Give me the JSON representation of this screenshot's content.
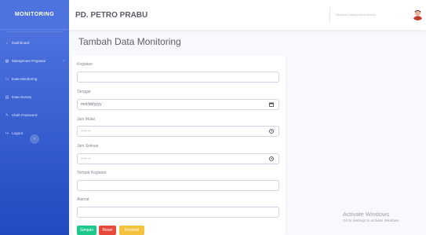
{
  "sidebar": {
    "brand": "MONITORING",
    "items": [
      {
        "label": "Dashboard",
        "icon": "⌂"
      },
      {
        "label": "Manajemen Pegawai",
        "icon": "▦",
        "chevron": "›"
      },
      {
        "label": "Data Monitoring",
        "icon": "▭"
      },
      {
        "label": "Data Survey",
        "icon": "▤"
      },
      {
        "label": "Ubah Password",
        "icon": "✎"
      },
      {
        "label": "Logout",
        "icon": "↦"
      }
    ],
    "toggle": "‹"
  },
  "topbar": {
    "title": "PD. PETRO PRABU",
    "greeting": "Selamat Datang anda Admin"
  },
  "page": {
    "heading": "Tambah Data Monitoring"
  },
  "form": {
    "kegiatan_label": "Kegiatan",
    "kegiatan_value": "",
    "tanggal_label": "Tanggal",
    "tanggal_placeholder": "mm/dd/yyyy",
    "jam_mulai_label": "Jam Mulai",
    "jam_mulai_placeholder": "--:-- --",
    "jam_selesai_label": "Jam Selesai",
    "jam_selesai_placeholder": "--:-- --",
    "tempat_label": "Tempat Kegiatan",
    "tempat_value": "",
    "alamat_label": "Alamat",
    "alamat_value": ""
  },
  "buttons": {
    "simpan": "Simpan",
    "reset": "Reset",
    "kembali": "Kembali"
  },
  "colors": {
    "sidebar_top": "#4e73df",
    "sidebar_bottom": "#224abe",
    "success": "#1cc88a",
    "danger": "#e74a3b",
    "warning": "#f6c23e"
  },
  "watermark": {
    "line1": "Activate Windows",
    "line2": "Go to Settings to activate Windows."
  }
}
